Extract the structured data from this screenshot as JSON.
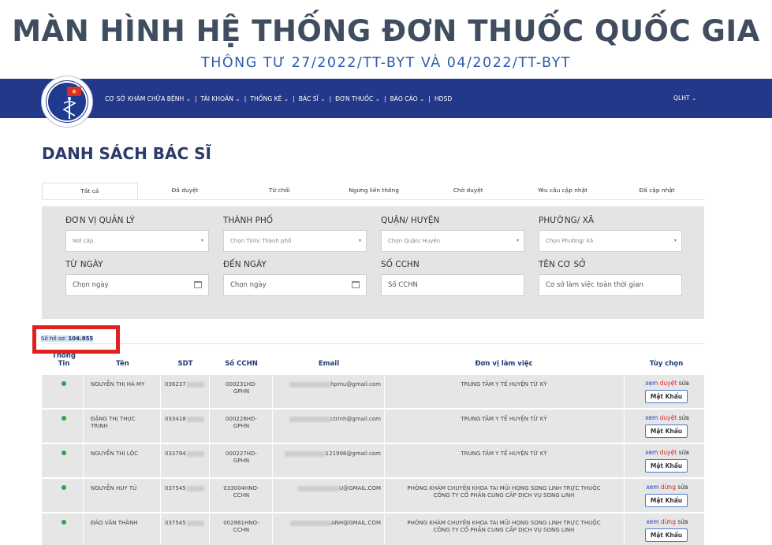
{
  "header": {
    "headline": "MÀN HÌNH HỆ THỐNG ĐƠN THUỐC QUỐC GIA",
    "subline": "THÔNG TƯ 27/2022/TT-BYT VÀ 04/2022/TT-BYT"
  },
  "logo": {
    "text_top": "BỘ Y TẾ",
    "text_bottom": "MINISTRY OF HEALTH"
  },
  "nav": {
    "items": [
      "CƠ SỞ KHÁM CHỮA BỆNH ⌄",
      "TÀI KHOẢN ⌄",
      "THỐNG KÊ ⌄",
      "BÁC SĨ ⌄",
      "ĐƠN THUỐC ⌄",
      "BÁO CÁO ⌄",
      "HDSD"
    ],
    "separator": "|",
    "user": "QLHT ⌄"
  },
  "page_title": "DANH SÁCH BÁC SĨ",
  "tabs": [
    "Tất cả",
    "Đã duyệt",
    "Từ chối",
    "Ngưng liên thông",
    "Chờ duyệt",
    "Yêu cầu cập nhật",
    "Đã cập nhật"
  ],
  "filters": {
    "labels": [
      "ĐƠN VỊ QUẢN LÝ",
      "THÀNH PHỐ",
      "QUẬN/ HUYỆN",
      "PHƯỜNG/ XÃ",
      "TỪ NGÀY",
      "ĐẾN NGÀY",
      "SỐ CCHN",
      "TÊN CƠ SỞ"
    ],
    "placeholders": [
      "Nơi cấp",
      "Chọn Tỉnh/ Thành phố",
      "Chọn Quận/ Huyện",
      "Chọn Phường/ Xã",
      "Chọn ngày",
      "Chọn ngày",
      "Số CCHN",
      "Cơ sở làm việc toàn thời gian"
    ],
    "caret": "▾"
  },
  "count": {
    "label": "Số hồ sơ:",
    "value": "104.855"
  },
  "table": {
    "headers": {
      "thongtin_1": "Thông",
      "thongtin_2": "Tin",
      "ten": "Tên",
      "sdt": "SDT",
      "cchn": "Số CCHN",
      "email": "Email",
      "donvi": "Đơn vị làm việc",
      "tuychon": "Tùy chọn"
    },
    "rows": [
      {
        "name_1": "NGUYỄN THỊ HÀ MY",
        "name_2": "",
        "phone": "036237",
        "cchn_1": "000231HD-",
        "cchn_2": "GPHN",
        "email": "hpmu@gmail.com",
        "unit_1": "TRUNG TÂM Y TẾ HUYỆN TỨ KỲ",
        "unit_2": "",
        "view": "xem",
        "status": "duyệt",
        "edit": "sửa",
        "mk": "Mật Khẩu"
      },
      {
        "name_1": "ĐẶNG THỊ THỤC",
        "name_2": "TRINH",
        "phone": "033418",
        "cchn_1": "000228HD-",
        "cchn_2": "GPHN",
        "email": "ctrinh@gmail.com",
        "unit_1": "TRUNG TÂM Y TẾ HUYỆN TỨ KỲ",
        "unit_2": "",
        "view": "xem",
        "status": "duyệt",
        "edit": "sửa",
        "mk": "Mật Khẩu"
      },
      {
        "name_1": "NGUYỄN THỊ LỘC",
        "name_2": "",
        "phone": "033794",
        "cchn_1": "000227HD-",
        "cchn_2": "GPHN",
        "email": "121998@gmail.com",
        "unit_1": "TRUNG TÂM Y TẾ HUYỆN TỨ KỲ",
        "unit_2": "",
        "view": "xem",
        "status": "duyệt",
        "edit": "sửa",
        "mk": "Mật Khẩu"
      },
      {
        "name_1": "NGUYỄN HUY TÚ",
        "name_2": "",
        "phone": "037545",
        "cchn_1": "033004HNO-",
        "cchn_2": "CCHN",
        "email": "U@GMAIL.COM",
        "unit_1": "PHÒNG KHÁM CHUYÊN KHOA TAI MŨI HỌNG SONG LINH TRỰC THUỘC",
        "unit_2": "CÔNG TY CỔ PHẦN CUNG CẤP DỊCH VỤ SONG LINH",
        "view": "xem",
        "status": "dừng",
        "edit": "sửa",
        "mk": "Mật Khẩu"
      },
      {
        "name_1": "ĐÀO VĂN THÀNH",
        "name_2": "",
        "phone": "037545",
        "cchn_1": "002861HNO-",
        "cchn_2": "CCHN",
        "email": "ANH@GMAIL.COM",
        "unit_1": "PHÒNG KHÁM CHUYÊN KHOA TAI MŨI HỌNG SONG LINH TRỰC THUỘC",
        "unit_2": "CÔNG TY CỔ PHẦN CUNG CẤP DỊCH VỤ SONG LINH",
        "view": "xem",
        "status": "dừng",
        "edit": "sửa",
        "mk": "Mật Khẩu"
      }
    ]
  },
  "colors": {
    "navbar": "#233888",
    "title": "#2b3a67",
    "status_dot": "#28a745",
    "highlight_box": "#e21f1f",
    "link": "#1e40c8",
    "status_text": "#e02424"
  }
}
